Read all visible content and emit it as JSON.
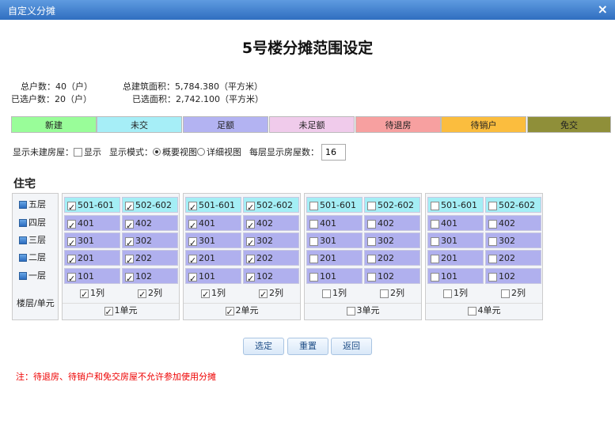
{
  "window": {
    "title": "自定义分摊",
    "close_glyph": "×"
  },
  "heading": "5号楼分摊范围设定",
  "stats": {
    "total_households": "总户数：40（户）",
    "selected_households": "已选户数：20（户）",
    "total_area": "总建筑面积：5,784.380（平方米）",
    "selected_area": "已选面积：2,742.100（平方米）"
  },
  "legend": [
    {
      "label": "新建",
      "color": "#99fd99"
    },
    {
      "label": "未交",
      "color": "#a6eef7"
    },
    {
      "label": "足额",
      "color": "#b3b3f2"
    },
    {
      "label": "未足额",
      "color": "#f0cbeb"
    },
    {
      "label": "待退房",
      "color": "#f7a0a0"
    },
    {
      "label": "待销户",
      "color": "#fbbd3e"
    },
    {
      "label": "免交",
      "color": "#8f8f39"
    }
  ],
  "options": {
    "show_unbuilt_label": "显示未建房屋：",
    "show_label": "显示",
    "mode_label": "显示模式：",
    "mode_summary": "概要视图",
    "mode_detail": "详细视图",
    "per_floor_label": "每层显示房屋数：",
    "per_floor_value": "16"
  },
  "section_title": "住宅",
  "floors": [
    "五层",
    "四层",
    "三层",
    "二层",
    "一层"
  ],
  "floor_unit_label": "楼层/单元",
  "units": [
    {
      "label": "1单元",
      "checked": true,
      "cols": [
        {
          "label": "1列",
          "checked": true
        },
        {
          "label": "2列",
          "checked": true
        }
      ],
      "rows": [
        [
          "501-601",
          "502-602"
        ],
        [
          "401",
          "402"
        ],
        [
          "301",
          "302"
        ],
        [
          "201",
          "202"
        ],
        [
          "101",
          "102"
        ]
      ],
      "cell_checked": true
    },
    {
      "label": "2单元",
      "checked": true,
      "cols": [
        {
          "label": "1列",
          "checked": true
        },
        {
          "label": "2列",
          "checked": true
        }
      ],
      "rows": [
        [
          "501-601",
          "502-602"
        ],
        [
          "401",
          "402"
        ],
        [
          "301",
          "302"
        ],
        [
          "201",
          "202"
        ],
        [
          "101",
          "102"
        ]
      ],
      "cell_checked": true
    },
    {
      "label": "3单元",
      "checked": false,
      "cols": [
        {
          "label": "1列",
          "checked": false
        },
        {
          "label": "2列",
          "checked": false
        }
      ],
      "rows": [
        [
          "501-601",
          "502-602"
        ],
        [
          "401",
          "402"
        ],
        [
          "301",
          "302"
        ],
        [
          "201",
          "202"
        ],
        [
          "101",
          "102"
        ]
      ],
      "cell_checked": false
    },
    {
      "label": "4单元",
      "checked": false,
      "cols": [
        {
          "label": "1列",
          "checked": false
        },
        {
          "label": "2列",
          "checked": false
        }
      ],
      "rows": [
        [
          "501-601",
          "502-602"
        ],
        [
          "401",
          "402"
        ],
        [
          "301",
          "302"
        ],
        [
          "201",
          "202"
        ],
        [
          "101",
          "102"
        ]
      ],
      "cell_checked": false
    }
  ],
  "buttons": {
    "select": "选定",
    "reset": "重置",
    "back": "返回"
  },
  "note": "注：待退房、待销户和免交房屋不允许参加使用分摊"
}
